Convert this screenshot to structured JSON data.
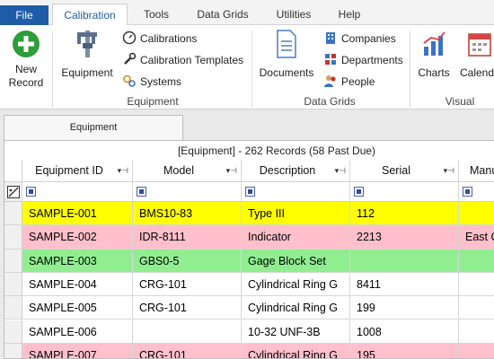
{
  "menu": {
    "tabs": [
      "File",
      "Calibration",
      "Tools",
      "Data Grids",
      "Utilities",
      "Help"
    ],
    "active": "Calibration"
  },
  "ribbon": {
    "new_record": "New Record",
    "equipment": "Equipment",
    "calibrations": "Calibrations",
    "calibration_templates": "Calibration Templates",
    "systems": "Systems",
    "group_equipment": "Equipment",
    "documents": "Documents",
    "companies": "Companies",
    "departments": "Departments",
    "people": "People",
    "group_data_grids": "Data Grids",
    "charts": "Charts",
    "calendar": "Calendar",
    "group_visual": "Visual"
  },
  "document_tab": "Equipment",
  "grid": {
    "caption": "[Equipment] - 262 Records (58 Past Due)",
    "columns": [
      "Equipment ID",
      "Model",
      "Description",
      "Serial",
      "Manufacturer"
    ],
    "rows": [
      {
        "cells": [
          "SAMPLE-001",
          "BMS10-83",
          "Type III",
          "112",
          ""
        ],
        "color": "#ffff00"
      },
      {
        "cells": [
          "SAMPLE-002",
          "IDR-8111",
          "Indicator",
          "2213",
          "East Coast"
        ],
        "color": "#ffc0cb"
      },
      {
        "cells": [
          "SAMPLE-003",
          "GBS0-5",
          "Gage Block Set",
          "",
          ""
        ],
        "color": "#90ee90"
      },
      {
        "cells": [
          "SAMPLE-004",
          "CRG-101",
          "Cylindrical Ring G",
          "8411",
          ""
        ],
        "color": "#ffffff"
      },
      {
        "cells": [
          "SAMPLE-005",
          "CRG-101",
          "Cylindrical Ring G",
          "199",
          ""
        ],
        "color": "#ffffff"
      },
      {
        "cells": [
          "SAMPLE-006",
          "",
          "10-32 UNF-3B",
          "1008",
          ""
        ],
        "color": "#ffffff"
      },
      {
        "cells": [
          "SAMPLE-007",
          "CRG-101",
          "Cylindrical Ring G",
          "195",
          ""
        ],
        "color": "#ffc0cb"
      }
    ]
  },
  "colors": {
    "file_tab": "#1e5ca8",
    "past_due": "#ffc0cb",
    "due_soon": "#ffff00",
    "ok": "#90ee90"
  }
}
